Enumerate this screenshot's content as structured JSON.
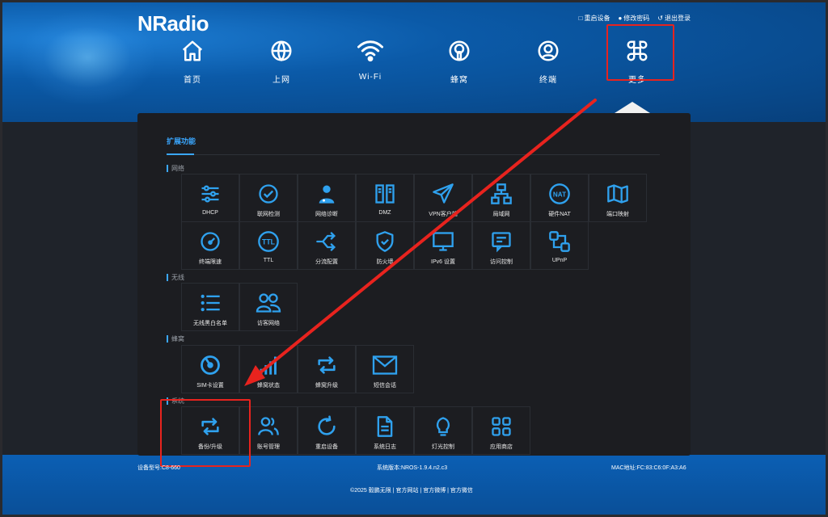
{
  "brand": {
    "logo": "NRadio"
  },
  "toplinks": {
    "reboot": "重启设备",
    "password": "修改密码",
    "logout": "退出登录"
  },
  "nav": [
    {
      "label": "首页",
      "icon": "home-icon"
    },
    {
      "label": "上网",
      "icon": "globe-icon"
    },
    {
      "label": "Wi-Fi",
      "icon": "wifi-icon"
    },
    {
      "label": "蜂窝",
      "icon": "cellular-icon"
    },
    {
      "label": "终端",
      "icon": "user-icon"
    },
    {
      "label": "更多",
      "icon": "more-grid-icon",
      "active": true
    }
  ],
  "panel": {
    "title": "扩展功能",
    "sections": {
      "network": "网络",
      "wireless": "无线",
      "cellular": "蜂窝",
      "system": "系统"
    },
    "network": [
      {
        "label": "DHCP",
        "icon": "sliders-icon"
      },
      {
        "label": "联网检测",
        "icon": "check-circle-icon"
      },
      {
        "label": "网络诊断",
        "icon": "doctor-icon"
      },
      {
        "label": "DMZ",
        "icon": "servers-icon"
      },
      {
        "label": "VPN客户端",
        "icon": "paper-plane-icon"
      },
      {
        "label": "局域网",
        "icon": "lan-icon"
      },
      {
        "label": "硬件NAT",
        "icon": "nat-icon"
      },
      {
        "label": "端口映射",
        "icon": "map-icon"
      },
      {
        "label": "终端限速",
        "icon": "speedometer-icon"
      },
      {
        "label": "TTL",
        "icon": "ttl-icon"
      },
      {
        "label": "分流配置",
        "icon": "shuffle-icon"
      },
      {
        "label": "防火墙",
        "icon": "shield-icon"
      },
      {
        "label": "IPv6 设置",
        "icon": "monitor-icon"
      },
      {
        "label": "访问控制",
        "icon": "message-icon"
      },
      {
        "label": "UPnP",
        "icon": "upnp-icon"
      }
    ],
    "wireless": [
      {
        "label": "无线黑白名单",
        "icon": "list-icon"
      },
      {
        "label": "访客网络",
        "icon": "users-icon"
      }
    ],
    "cellular": [
      {
        "label": "SIM卡设置",
        "icon": "dial-icon"
      },
      {
        "label": "蜂窝状态",
        "icon": "signal-icon"
      },
      {
        "label": "蜂窝升级",
        "icon": "refresh-square-icon"
      },
      {
        "label": "短信会话",
        "icon": "mail-icon"
      }
    ],
    "system": [
      {
        "label": "备份/升级",
        "icon": "backup-icon",
        "highlighted": true
      },
      {
        "label": "账号管理",
        "icon": "accounts-icon"
      },
      {
        "label": "重启设备",
        "icon": "restart-icon"
      },
      {
        "label": "系统日志",
        "icon": "document-icon"
      },
      {
        "label": "灯光控制",
        "icon": "bulb-icon"
      },
      {
        "label": "应用商店",
        "icon": "apps-icon"
      }
    ]
  },
  "footer": {
    "model": "设备型号:C8-660",
    "version": "系统版本:NROS-1.9.4.n2.c3",
    "mac": "MAC地址:FC:83:C6:0F:A3:A6",
    "copyright": "©2025 毅鹏无限",
    "links": [
      "官方网站",
      "官方微博",
      "官方微信"
    ]
  },
  "colors": {
    "accent": "#3aa7ff",
    "highlight": "#e8231e",
    "panel": "#1c1d21"
  }
}
